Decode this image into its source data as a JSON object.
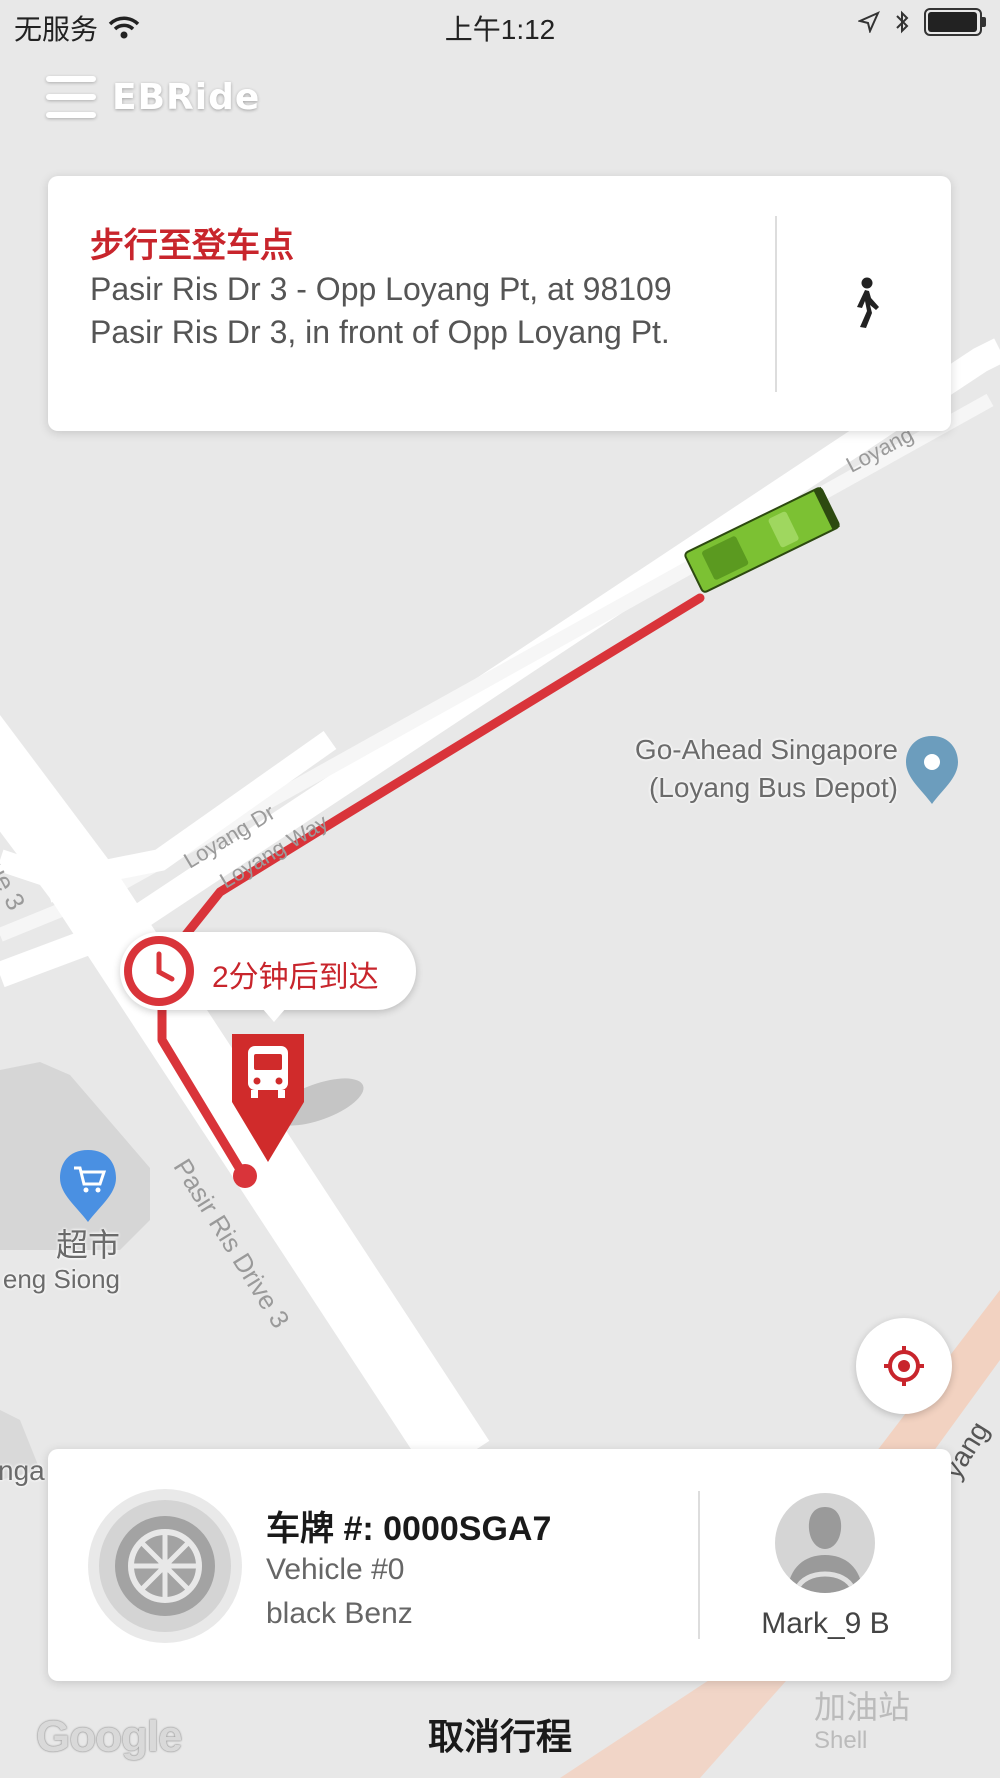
{
  "status_bar": {
    "carrier": "无服务",
    "time": "上午1:12",
    "battery_level": 0.9
  },
  "header": {
    "brand": "EBRide",
    "menu_icon": "hamburger-menu-icon"
  },
  "walk_card": {
    "title": "步行至登车点",
    "address": "Pasir Ris Dr 3 - Opp Loyang Pt, at 98109 Pasir Ris Dr 3, in front of Opp Loyang Pt.",
    "icon": "walking-person-icon"
  },
  "map": {
    "roads": {
      "loyang_dr": "Loyang Dr",
      "loyang_way": "Loyang Way",
      "pasir_ris_drive_3": "Pasir Ris Drive 3",
      "loyang_top": "Loyang",
      "left_edge": "ue 3",
      "right_edge": "yang"
    },
    "poi_depot": {
      "line1": "Go-Ahead Singapore",
      "line2": "(Loyang Bus Depot)",
      "icon": "map-pin-icon"
    },
    "poi_supermarket": {
      "line1": "超市",
      "line2": "eng Siong",
      "icon": "shopping-cart-icon"
    },
    "poi_left_bottom": "nga",
    "gas_station": {
      "line1": "加油站",
      "line2": "Shell"
    },
    "route_color": "#d9343a",
    "vehicle_color": "#7cc133"
  },
  "eta_bubble": {
    "text": "2分钟后到达",
    "icon": "clock-icon"
  },
  "bus_marker_icon": "bus-stop-marker-icon",
  "locate_button_icon": "crosshair-locate-icon",
  "driver_card": {
    "plate": "车牌 #: 0000SGA7",
    "vehicle": "Vehicle #0",
    "model": "black Benz",
    "driver_name": "Mark_9 B",
    "vehicle_icon": "steering-wheel-icon",
    "driver_icon": "driver-avatar-icon"
  },
  "cancel_label": "取消行程",
  "attribution": "Google",
  "accent_color": "#c8252c"
}
